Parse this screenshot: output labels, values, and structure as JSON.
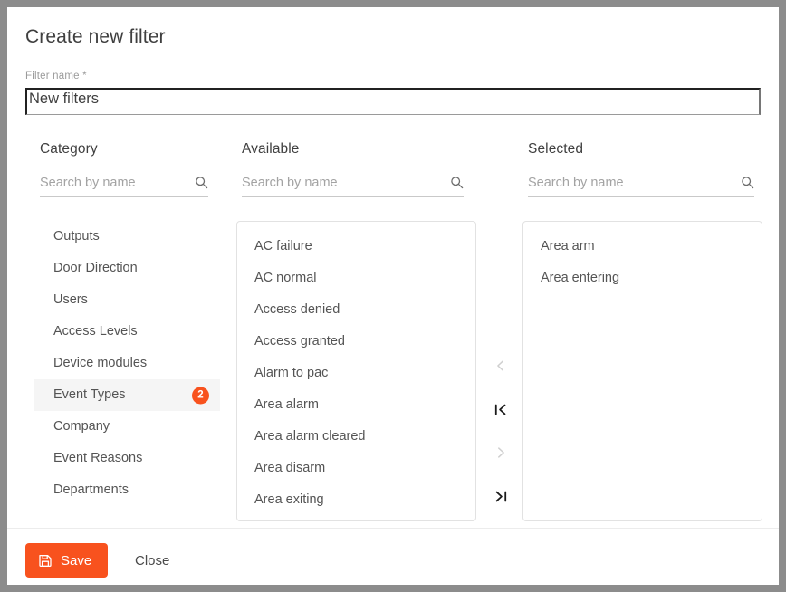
{
  "dialog": {
    "title": "Create new filter"
  },
  "filter_name": {
    "label": "Filter name *",
    "value": "New filters",
    "placeholder": ""
  },
  "category": {
    "heading": "Category",
    "search_placeholder": "Search by name",
    "search_value": "",
    "search_icon": "search-icon",
    "items": [
      {
        "label": "Outputs",
        "selected": false,
        "badge": ""
      },
      {
        "label": "Door Direction",
        "selected": false,
        "badge": ""
      },
      {
        "label": "Users",
        "selected": false,
        "badge": ""
      },
      {
        "label": "Access Levels",
        "selected": false,
        "badge": ""
      },
      {
        "label": "Device modules",
        "selected": false,
        "badge": ""
      },
      {
        "label": "Event Types",
        "selected": true,
        "badge": "2"
      },
      {
        "label": "Company",
        "selected": false,
        "badge": ""
      },
      {
        "label": "Event Reasons",
        "selected": false,
        "badge": ""
      },
      {
        "label": "Departments",
        "selected": false,
        "badge": ""
      }
    ]
  },
  "available": {
    "heading": "Available",
    "search_placeholder": "Search by name",
    "search_value": "",
    "search_icon": "search-icon",
    "items": [
      "AC failure",
      "AC normal",
      "Access denied",
      "Access granted",
      "Alarm to pac",
      "Area alarm",
      "Area alarm cleared",
      "Area disarm",
      "Area exiting"
    ]
  },
  "selected": {
    "heading": "Selected",
    "search_placeholder": "Search by name",
    "search_value": "",
    "search_icon": "search-icon",
    "items": [
      "Area arm",
      "Area entering"
    ]
  },
  "transfer": {
    "buttons": [
      {
        "name": "move-left-icon",
        "glyph": "chevron-left",
        "state": "disabled"
      },
      {
        "name": "move-all-left-icon",
        "glyph": "chevron-left-bar",
        "state": "active"
      },
      {
        "name": "move-right-icon",
        "glyph": "chevron-right",
        "state": "disabled"
      },
      {
        "name": "move-all-right-icon",
        "glyph": "chevron-right-bar",
        "state": "active"
      }
    ]
  },
  "footer": {
    "save_label": "Save",
    "save_icon": "save-disk-icon",
    "close_label": "Close"
  },
  "colors": {
    "accent": "#f8521e",
    "badge": "#f8521e",
    "backdrop": "#8c8c8c",
    "dialog_bg": "#ffffff",
    "selected_row": "#f5f5f5",
    "panel_border": "#e2e2e2",
    "text_primary": "#3f3f3f",
    "text_secondary": "#545454",
    "text_muted": "#9b9b9b"
  }
}
